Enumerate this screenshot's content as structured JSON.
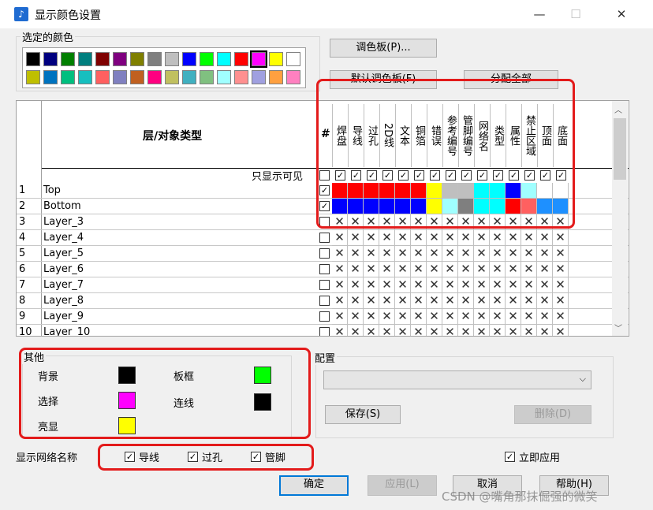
{
  "window": {
    "title": "显示颜色设置",
    "minimize": "—",
    "maximize": "☐",
    "close": "✕"
  },
  "selected_colors": {
    "label": "选定的颜色",
    "row1": [
      "#000000",
      "#00007f",
      "#007f00",
      "#007f7f",
      "#7f0000",
      "#7f007f",
      "#7f7f00",
      "#7f7f7f",
      "#bfbfbf",
      "#0000ff",
      "#00ff00",
      "#00ffff",
      "#ff0000",
      "#ff00ff",
      "#ffff00",
      "#ffffff"
    ],
    "row2": [
      "#bfbf00",
      "#0073bf",
      "#00bf7f",
      "#17bfbf",
      "#ff6060",
      "#8080c0",
      "#c06020",
      "#ff0080",
      "#c0c060",
      "#40b0c0",
      "#80c080",
      "#a0ffff",
      "#ff9090",
      "#a0a0e0",
      "#ffa040",
      "#ff80c0"
    ],
    "selected_index": 13
  },
  "buttons": {
    "palette": "调色板(P)...",
    "default_palette": "默认调色板(F)",
    "assign_all": "分配全部",
    "save": "保存(S)",
    "delete": "删除(D)",
    "ok": "确定",
    "apply": "应用(L)",
    "cancel": "取消",
    "help": "帮助(H)"
  },
  "grid": {
    "header_title": "层/对象类型",
    "hash": "#",
    "only_visible_label": "只显示可见",
    "columns": [
      "焊盘",
      "导线",
      "过孔",
      "2D线",
      "文本",
      "铜箔",
      "错误",
      "参考编号",
      "管脚编号",
      "网络名",
      "类型",
      "属性",
      "禁止区域",
      "顶面",
      "底面"
    ],
    "rows": [
      {
        "num": "1",
        "name": "Top",
        "checked": true,
        "colors": [
          "#ff0000",
          "#ff0000",
          "#ff0000",
          "#ff0000",
          "#ff0000",
          "#ff0000",
          "#ffff00",
          "#bfbfbf",
          "#bfbfbf",
          "#00ffff",
          "#00ffff",
          "#0000ff",
          "#a0ffff",
          "#ffffff",
          "#ffffff"
        ]
      },
      {
        "num": "2",
        "name": "Bottom",
        "checked": true,
        "colors": [
          "#0000ff",
          "#0000ff",
          "#0000ff",
          "#0000ff",
          "#0000ff",
          "#0000ff",
          "#ffff00",
          "#a0ffff",
          "#7f7f7f",
          "#00ffff",
          "#00ffff",
          "#ff0000",
          "#ff6060",
          "#1e90ff",
          "#1e90ff"
        ]
      },
      {
        "num": "3",
        "name": "Layer_3",
        "checked": false,
        "colors": []
      },
      {
        "num": "4",
        "name": "Layer_4",
        "checked": false,
        "colors": []
      },
      {
        "num": "5",
        "name": "Layer_5",
        "checked": false,
        "colors": []
      },
      {
        "num": "6",
        "name": "Layer_6",
        "checked": false,
        "colors": []
      },
      {
        "num": "7",
        "name": "Layer_7",
        "checked": false,
        "colors": []
      },
      {
        "num": "8",
        "name": "Layer_8",
        "checked": false,
        "colors": []
      },
      {
        "num": "9",
        "name": "Layer_9",
        "checked": false,
        "colors": []
      },
      {
        "num": "10",
        "name": "Layer_10",
        "checked": false,
        "colors": []
      }
    ]
  },
  "other": {
    "label": "其他",
    "background_label": "背景",
    "background_color": "#000000",
    "select_label": "选择",
    "select_color": "#ff00ff",
    "highlight_label": "亮显",
    "highlight_color": "#ffff00",
    "board_label": "板框",
    "board_color": "#00ff00",
    "connection_label": "连线",
    "connection_color": "#000000"
  },
  "config": {
    "label": "配置",
    "value": ""
  },
  "net_names": {
    "label": "显示网络名称",
    "trace": "导线",
    "via": "过孔",
    "pin": "管脚"
  },
  "apply_now": "立即应用",
  "watermark": "CSDN @嘴角那抹倔强的微笑"
}
